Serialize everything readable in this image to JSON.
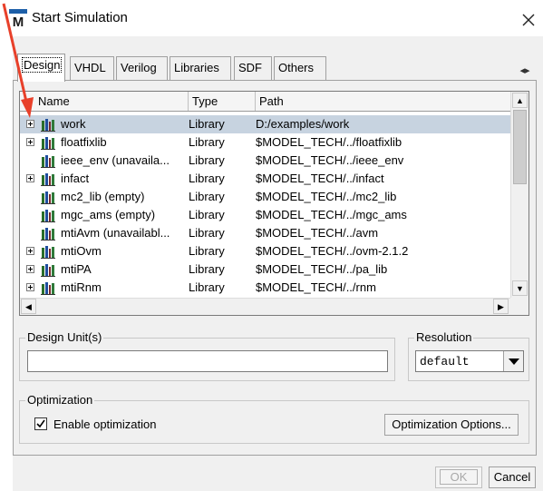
{
  "window": {
    "title": "Start Simulation",
    "app_icon_letter": "M"
  },
  "tabs": [
    {
      "label": "Design",
      "active": true
    },
    {
      "label": "VHDL",
      "active": false
    },
    {
      "label": "Verilog",
      "active": false
    },
    {
      "label": "Libraries",
      "active": false
    },
    {
      "label": "SDF",
      "active": false
    },
    {
      "label": "Others",
      "active": false
    }
  ],
  "library_list": {
    "columns": [
      "Name",
      "Type",
      "Path"
    ],
    "rows": [
      {
        "name": "work",
        "type": "Library",
        "path": "D:/examples/work",
        "expandable": true,
        "selected": true
      },
      {
        "name": "floatfixlib",
        "type": "Library",
        "path": "$MODEL_TECH/../floatfixlib",
        "expandable": true,
        "selected": false
      },
      {
        "name": "ieee_env  (unavaila...",
        "type": "Library",
        "path": "$MODEL_TECH/../ieee_env",
        "expandable": false,
        "selected": false
      },
      {
        "name": "infact",
        "type": "Library",
        "path": "$MODEL_TECH/../infact",
        "expandable": true,
        "selected": false
      },
      {
        "name": "mc2_lib  (empty)",
        "type": "Library",
        "path": "$MODEL_TECH/../mc2_lib",
        "expandable": false,
        "selected": false
      },
      {
        "name": "mgc_ams  (empty)",
        "type": "Library",
        "path": "$MODEL_TECH/../mgc_ams",
        "expandable": false,
        "selected": false
      },
      {
        "name": "mtiAvm  (unavailabl...",
        "type": "Library",
        "path": "$MODEL_TECH/../avm",
        "expandable": false,
        "selected": false
      },
      {
        "name": "mtiOvm",
        "type": "Library",
        "path": "$MODEL_TECH/../ovm-2.1.2",
        "expandable": true,
        "selected": false
      },
      {
        "name": "mtiPA",
        "type": "Library",
        "path": "$MODEL_TECH/../pa_lib",
        "expandable": true,
        "selected": false
      },
      {
        "name": "mtiRnm",
        "type": "Library",
        "path": "$MODEL_TECH/../rnm",
        "expandable": true,
        "selected": false
      }
    ]
  },
  "design_units": {
    "label": "Design Unit(s)",
    "value": ""
  },
  "resolution": {
    "label": "Resolution",
    "value": "default"
  },
  "optimization": {
    "label": "Optimization",
    "enable_label": "Enable optimization",
    "enabled": true,
    "options_button": "Optimization Options..."
  },
  "buttons": {
    "ok": "OK",
    "cancel": "Cancel"
  },
  "colors": {
    "selection": "#c7d3e0",
    "annotation_arrow": "#e8402a"
  }
}
